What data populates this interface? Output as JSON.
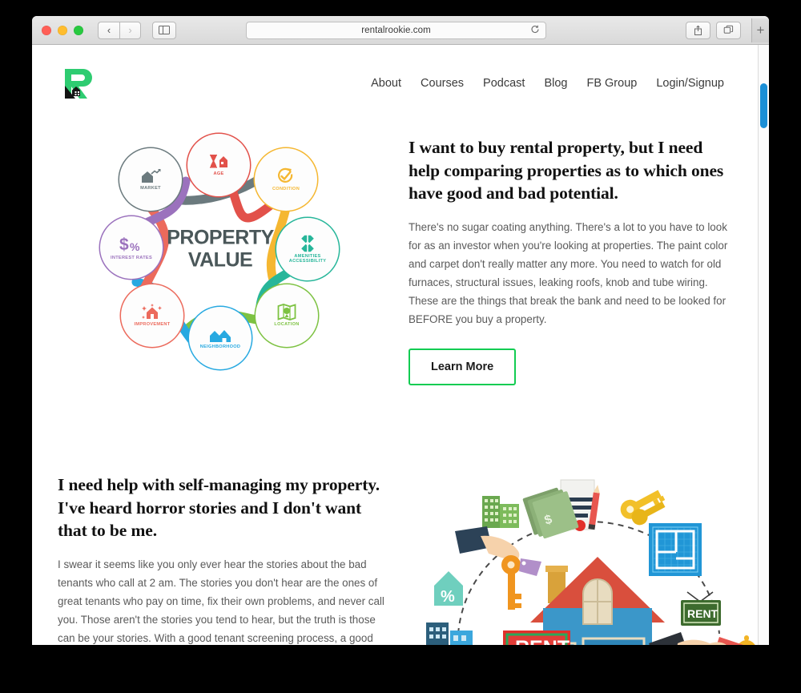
{
  "browser": {
    "url": "rentalrookie.com",
    "reload_icon": "reload-icon",
    "back_icon": "‹",
    "forward_icon": "›",
    "share_icon": "share-icon",
    "tabs_icon": "tabs-icon",
    "newtab_label": "+",
    "scroll_arrows": "▸▸"
  },
  "site": {
    "logo_alt": "Rental Rookie logo",
    "nav": [
      {
        "label": "About"
      },
      {
        "label": "Courses"
      },
      {
        "label": "Podcast"
      },
      {
        "label": "Blog"
      },
      {
        "label": "FB Group"
      },
      {
        "label": "Login/Signup"
      }
    ]
  },
  "hero": {
    "headline_plain": "I want to buy rental property, but I need help comparing properties as to which ones ",
    "headline_bold": "have good and bad potential.",
    "body": "There's no sugar coating anything. There's a lot to you have to look for as an investor when you're looking at properties.  The paint color and carpet don't really matter any more.  You need to watch for old furnaces, structural issues, leaking roofs, knob and tube wiring.  These are the things that break the bank and need to be looked for BEFORE you buy a property.",
    "cta_label": "Learn More"
  },
  "infographic": {
    "center_line1": "PROPERTY",
    "center_line2": "VALUE",
    "nodes": [
      {
        "label": "MARKET",
        "icon": "house-chart-icon",
        "glyph": "🏠",
        "color": "#6b7a7e"
      },
      {
        "label": "AGE",
        "icon": "hourglass-house-icon",
        "glyph": "⌛",
        "color": "#e2514a"
      },
      {
        "label": "CONDITION",
        "icon": "check-refresh-icon",
        "glyph": "✔",
        "color": "#f5b731"
      },
      {
        "label": "AMENITIES ACCESSIBILITY",
        "icon": "arrows-in-icon",
        "glyph": "✥",
        "color": "#27b69a"
      },
      {
        "label": "LOCATION",
        "icon": "map-pin-icon",
        "glyph": "📍",
        "color": "#7dc242"
      },
      {
        "label": "NEIGHBORHOOD",
        "icon": "houses-icon",
        "glyph": "🏘",
        "color": "#27a9e1"
      },
      {
        "label": "IMPROVEMENT",
        "icon": "sparkle-house-icon",
        "glyph": "✨",
        "color": "#ec6a5c"
      },
      {
        "label": "INTEREST RATES",
        "icon": "dollar-percent-icon",
        "glyph": "$%",
        "color": "#9b72bd"
      }
    ]
  },
  "section_two": {
    "headline_pre": "I need help with ",
    "headline_bold": "self-managing my property.",
    "headline_post": " I've heard horror stories and I don't want that to be me.",
    "body": "I swear it seems like you only ever hear the stories about the bad tenants who call at 2 am. The stories you don't hear are the ones of great tenants who pay on time, fix their own problems, and never call you. Those aren't the stories you tend to hear, but the truth is those can be your stories.  With a good tenant screening process, a good property and a stand out listing you can have your properties listed to your best possible tenants.",
    "illustration": {
      "name": "property-management-illustration",
      "rent_sign_label": "RENT",
      "rent_hanging_label": "RENT",
      "percent_label": "%"
    }
  },
  "colors": {
    "brand_green": "#12cc52",
    "logo_green": "#2ecc71",
    "scrollbar_blue": "#1b8fd6",
    "body_text": "#5a5a5a",
    "heading_text": "#111111"
  }
}
